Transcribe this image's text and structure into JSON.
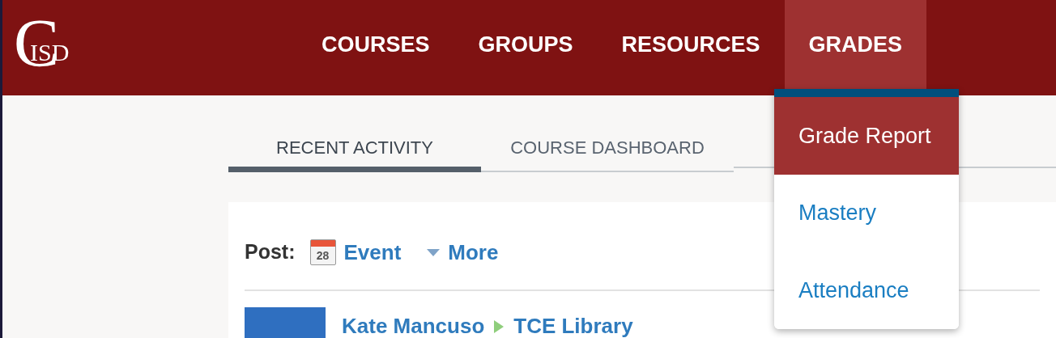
{
  "logo": {
    "initial": "C",
    "text": "ISD"
  },
  "nav": [
    {
      "label": "COURSES",
      "selected": false
    },
    {
      "label": "GROUPS",
      "selected": false
    },
    {
      "label": "RESOURCES",
      "selected": false
    },
    {
      "label": "GRADES",
      "selected": true
    }
  ],
  "dropdown": [
    {
      "label": "Grade Report",
      "selected": true
    },
    {
      "label": "Mastery",
      "selected": false
    },
    {
      "label": "Attendance",
      "selected": false
    }
  ],
  "tabs": [
    {
      "label": "RECENT ACTIVITY",
      "selected": true
    },
    {
      "label": "COURSE DASHBOARD",
      "selected": false
    }
  ],
  "post": {
    "label": "Post:",
    "calendar_day": "28",
    "event": "Event",
    "more": "More"
  },
  "activity": {
    "author": "Kate Mancuso",
    "target": "TCE Library"
  }
}
